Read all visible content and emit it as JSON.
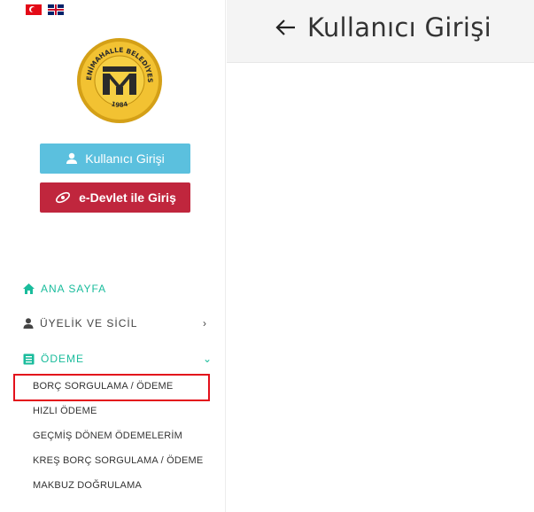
{
  "header": {
    "title": "Kullanıcı Girişi"
  },
  "flags": [
    "turkish-flag",
    "english-flag"
  ],
  "logo": {
    "top_text": "YENİMAHALLE BELEDİYESİ",
    "year": "1984"
  },
  "auth": {
    "login_label": "Kullanıcı Girişi",
    "edevlet_label": "e-Devlet ile Giriş"
  },
  "nav": {
    "home": "ANA SAYFA",
    "uyelik": "ÜYELİK VE SİCİL",
    "odeme": "ÖDEME"
  },
  "odeme_items": [
    "BORÇ SORGULAMA / ÖDEME",
    "HIZLI ÖDEME",
    "GEÇMİŞ DÖNEM ÖDEMELERİM",
    "KREŞ BORÇ SORGULAMA / ÖDEME",
    "MAKBUZ DOĞRULAMA"
  ],
  "colors": {
    "accent": "#1abc9c",
    "login_button": "#5bc0de",
    "edevlet_button": "#c0263d",
    "highlight": "#e3101b"
  }
}
